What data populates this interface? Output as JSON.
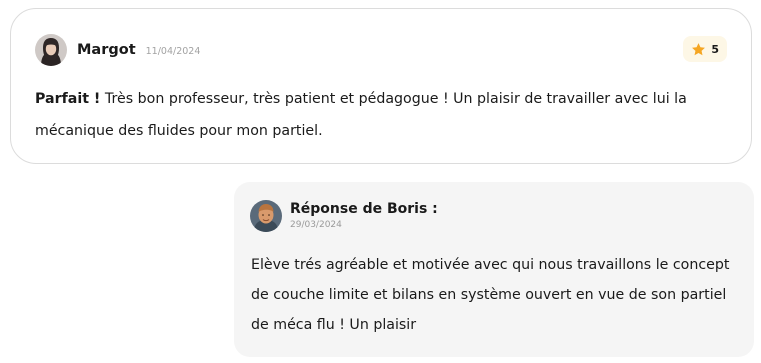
{
  "review": {
    "author": "Margot",
    "date": "11/04/2024",
    "rating": "5",
    "headline": "Parfait !",
    "body": " Très bon professeur, très patient et pédagogue ! Un plaisir de travailler avec lui la mécanique des fluides pour mon partiel.",
    "avatar_icon": "user-avatar-photo",
    "star_icon": "star-icon",
    "star_color": "#f5a623",
    "badge_color": "#fdf7e6"
  },
  "reply": {
    "title": "Réponse de Boris :",
    "date": "29/03/2024",
    "body": "Elève trés agréable et motivée avec qui nous travaillons le concept de couche limite et bilans en système ouvert en vue de son partiel de méca flu ! Un plaisir",
    "avatar_icon": "tutor-avatar-photo",
    "background_color": "#f5f5f5"
  }
}
